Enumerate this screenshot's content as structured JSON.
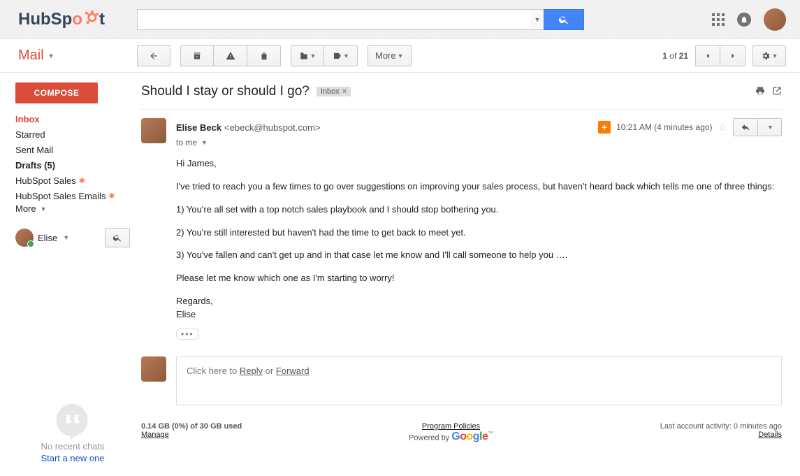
{
  "brand": {
    "name_left": "HubSp",
    "name_letter": "o",
    "name_right": "t"
  },
  "search": {
    "placeholder": ""
  },
  "mail_label": "Mail",
  "compose_label": "COMPOSE",
  "sidebar": {
    "items": [
      {
        "label": "Inbox",
        "active": true
      },
      {
        "label": "Starred"
      },
      {
        "label": "Sent Mail"
      },
      {
        "label": "Drafts (5)",
        "bold": true
      },
      {
        "label": "HubSpot Sales",
        "sprocket": true
      },
      {
        "label": "HubSpot Sales Emails",
        "sprocket": true
      }
    ],
    "more": "More"
  },
  "chat_user": "Elise",
  "hangouts": {
    "empty": "No recent chats",
    "start": "Start a new one"
  },
  "toolbar": {
    "more": "More",
    "pagination": {
      "current": "1",
      "of": "of",
      "total": "21"
    }
  },
  "thread": {
    "subject": "Should I stay or should I go?",
    "label_chip": "Inbox",
    "message": {
      "from_name": "Elise Beck",
      "from_email": "<ebeck@hubspot.com>",
      "to_line": "to me",
      "timestamp": "10:21 AM (4 minutes ago)",
      "paragraphs": [
        "Hi James,",
        "I've tried to reach you a few times to go over suggestions on improving your sales process, but haven't heard back which tells me one of three things:",
        "1) You're all set with a top notch sales playbook and I should stop bothering you.",
        "2) You're still interested but haven't had the time to get back to meet yet.",
        "3) You've fallen and can't get up and in that case let me know and I'll call someone to help you ….",
        "Please let me know which one as I'm starting to worry!",
        "Regards,",
        "Elise"
      ]
    },
    "reply_hint_pre": "Click here to ",
    "reply_hint_reply": "Reply",
    "reply_hint_mid": " or ",
    "reply_hint_forward": "Forward"
  },
  "footer": {
    "storage": "0.14 GB (0%) of 30 GB used",
    "manage": "Manage",
    "policies": "Program Policies",
    "powered": "Powered by ",
    "activity": "Last account activity: 0 minutes ago",
    "details": "Details"
  }
}
